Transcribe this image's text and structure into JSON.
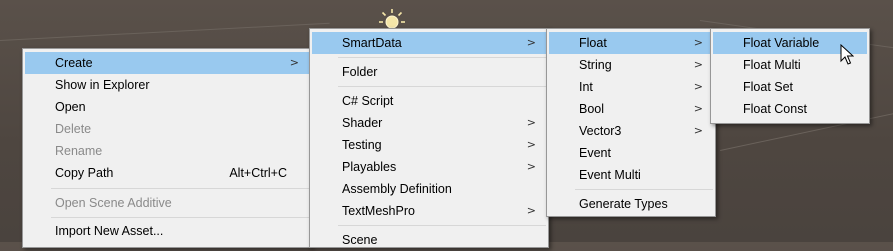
{
  "menus": {
    "context": {
      "items": [
        {
          "label": "Create",
          "submenu": true,
          "highlighted": true
        },
        {
          "label": "Show in Explorer"
        },
        {
          "label": "Open"
        },
        {
          "label": "Delete",
          "disabled": true
        },
        {
          "label": "Rename",
          "disabled": true
        },
        {
          "label": "Copy Path",
          "shortcut": "Alt+Ctrl+C"
        },
        {
          "label": "Open Scene Additive",
          "disabled": true
        },
        {
          "label": "Import New Asset..."
        }
      ]
    },
    "create": {
      "items": [
        {
          "label": "SmartData",
          "submenu": true,
          "highlighted": true
        },
        {
          "label": "Folder"
        },
        {
          "label": "C# Script"
        },
        {
          "label": "Shader",
          "submenu": true
        },
        {
          "label": "Testing",
          "submenu": true
        },
        {
          "label": "Playables",
          "submenu": true
        },
        {
          "label": "Assembly Definition"
        },
        {
          "label": "TextMeshPro",
          "submenu": true
        },
        {
          "label": "Scene"
        }
      ]
    },
    "smartdata": {
      "items": [
        {
          "label": "Float",
          "submenu": true,
          "highlighted": true
        },
        {
          "label": "String",
          "submenu": true
        },
        {
          "label": "Int",
          "submenu": true
        },
        {
          "label": "Bool",
          "submenu": true
        },
        {
          "label": "Vector3",
          "submenu": true
        },
        {
          "label": "Event"
        },
        {
          "label": "Event Multi"
        },
        {
          "label": "Generate Types"
        }
      ]
    },
    "float": {
      "items": [
        {
          "label": "Float Variable",
          "highlighted": true
        },
        {
          "label": "Float Multi"
        },
        {
          "label": "Float Set"
        },
        {
          "label": "Float Const"
        }
      ]
    }
  },
  "arrow_glyph": ">",
  "colors": {
    "highlight": "#99c9ef",
    "menu_bg": "#f0f0f0",
    "disabled_text": "#8a8a8a"
  },
  "icons": {
    "sun": "sun-icon",
    "cursor": "mouse-cursor-icon"
  }
}
